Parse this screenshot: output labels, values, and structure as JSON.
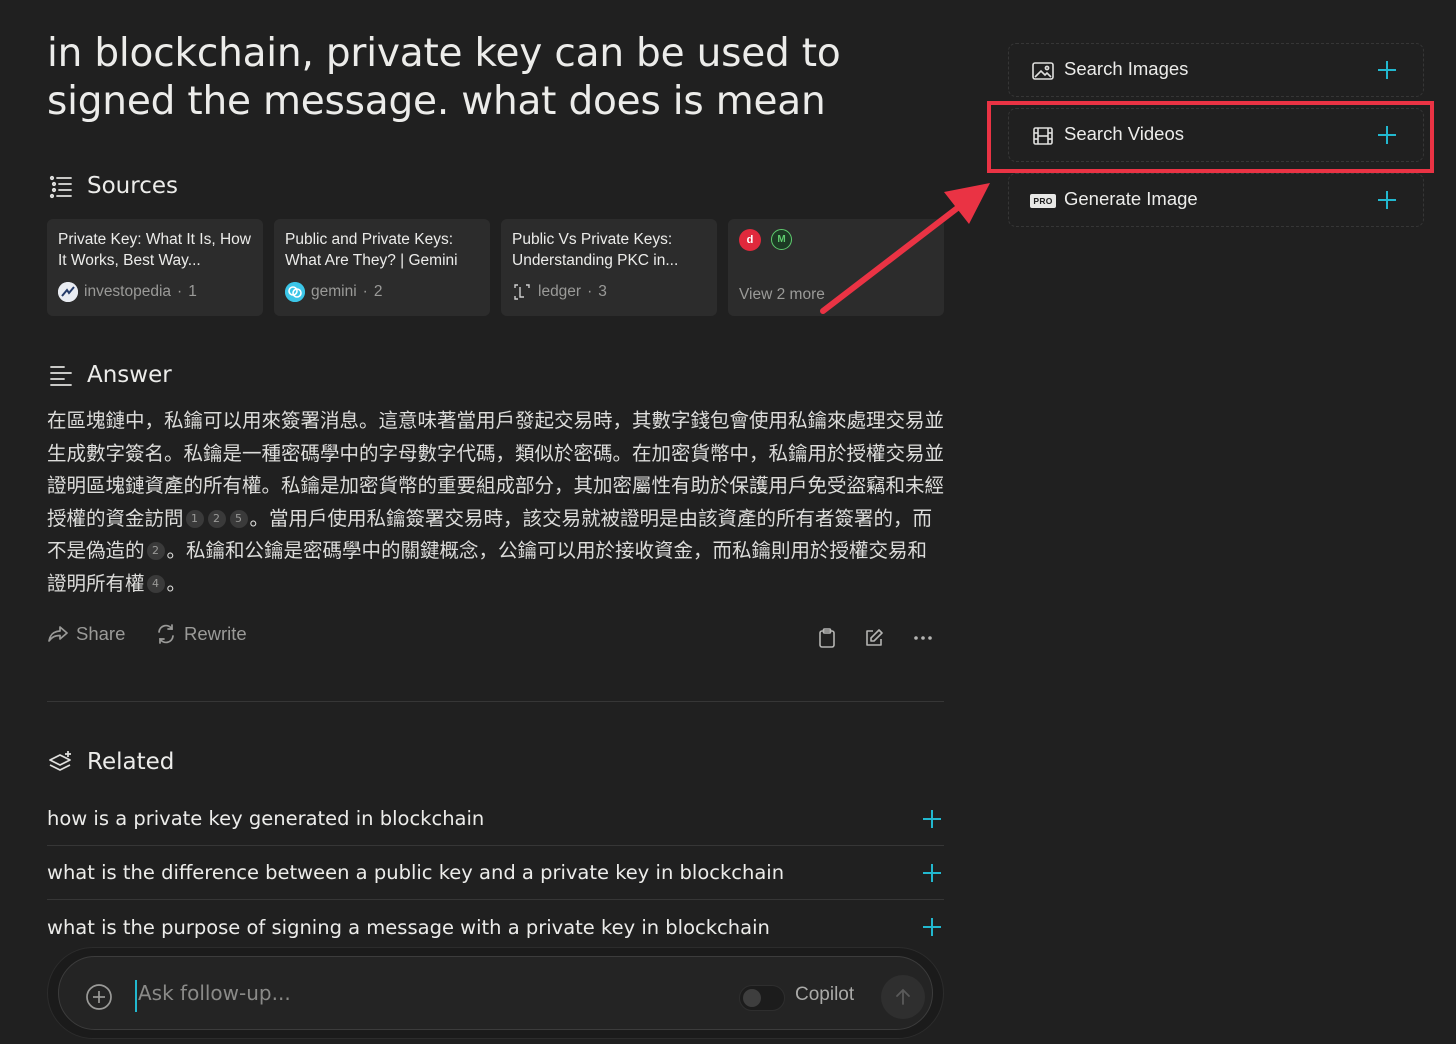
{
  "question": "in blockchain, private key can be used to signed the message. what does is mean",
  "sources": {
    "heading": "Sources",
    "cards": [
      {
        "title": "Private Key: What It Is, How It Works, Best Way...",
        "site": "investopedia",
        "index": "1",
        "favicon": "investopedia-icon"
      },
      {
        "title": "Public and Private Keys: What Are They? | Gemini",
        "site": "gemini",
        "index": "2",
        "favicon": "gemini-icon"
      },
      {
        "title": "Public Vs Private Keys: Understanding PKC in...",
        "site": "ledger",
        "index": "3",
        "favicon": "ledger-icon"
      }
    ],
    "more_label": "View 2 more",
    "more_favicons": [
      "d",
      "M"
    ]
  },
  "answer": {
    "heading": "Answer",
    "segments": [
      {
        "text": "在區塊鏈中，私鑰可以用來簽署消息。這意味著當用戶發起交易時，其數字錢包會使用私鑰來處理交易並生成數字簽名。私鑰是一種密碼學中的字母數字代碼，類似於密碼。在加密貨幣中，私鑰用於授權交易並證明區塊鏈資產的所有權。私鑰是加密貨幣的重要組成部分，其加密屬性有助於保護用戶免受盜竊和未經授權的資金訪問",
        "cites": [
          "1",
          "2",
          "5"
        ]
      },
      {
        "text": "。當用戶使用私鑰簽署交易時，該交易就被證明是由該資產的所有者簽署的，而不是偽造的",
        "cites": [
          "2"
        ]
      },
      {
        "text": "。私鑰和公鑰是密碼學中的關鍵概念，公鑰可以用於接收資金，而私鑰則用於授權交易和證明所有權",
        "cites": [
          "4"
        ]
      },
      {
        "text": "。",
        "cites": []
      }
    ],
    "share_label": "Share",
    "rewrite_label": "Rewrite"
  },
  "related": {
    "heading": "Related",
    "items": [
      "how is a private key generated in blockchain",
      "what is the difference between a public key and a private key in blockchain",
      "what is the purpose of signing a message with a private key in blockchain"
    ]
  },
  "composer": {
    "placeholder": "Ask follow-up...",
    "copilot_label": "Copilot"
  },
  "sidebar": {
    "items": [
      {
        "label": "Search Images",
        "icon": "image-icon"
      },
      {
        "label": "Search Videos",
        "icon": "film-icon"
      },
      {
        "label": "Generate Image",
        "icon": "pro-badge-icon"
      }
    ],
    "pro_badge": "PRO"
  },
  "colors": {
    "background": "#202020",
    "accent": "#22b8cf",
    "highlight": "#ea3344"
  }
}
